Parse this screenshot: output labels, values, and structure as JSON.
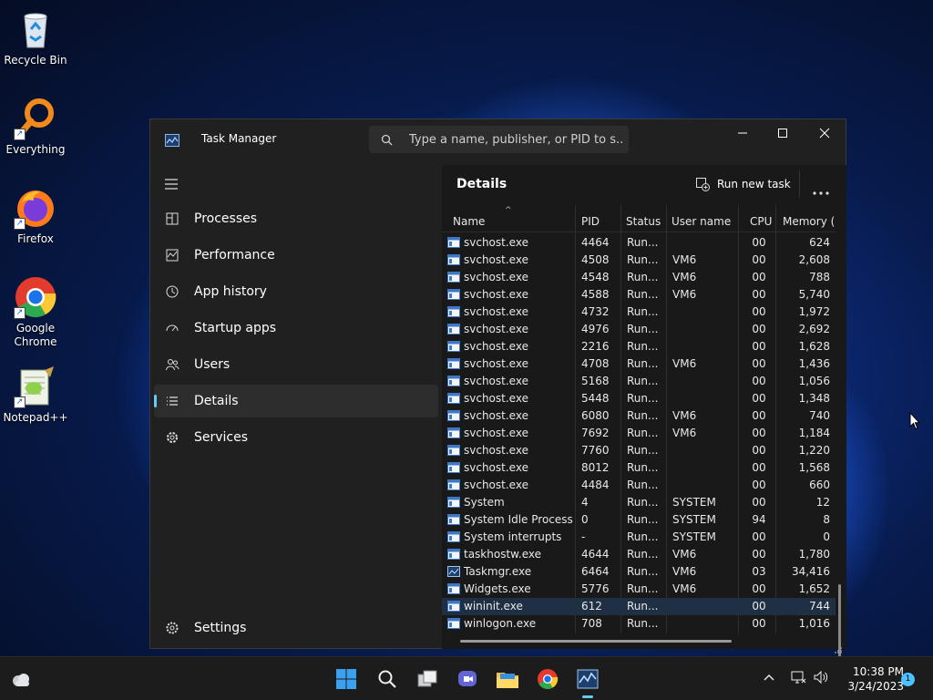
{
  "desktop": {
    "icons": [
      {
        "label": "Recycle Bin",
        "icon": "recycle-bin-icon"
      },
      {
        "label": "Everything",
        "icon": "everything-search-icon"
      },
      {
        "label": "Firefox",
        "icon": "firefox-icon"
      },
      {
        "label": "Google Chrome",
        "icon": "chrome-icon"
      },
      {
        "label": "Notepad++",
        "icon": "notepad-plus-plus-icon"
      }
    ]
  },
  "task_manager": {
    "title": "Task Manager",
    "search": {
      "placeholder": "Type a name, publisher, or PID to s..."
    },
    "nav": {
      "items": [
        {
          "label": "Processes",
          "icon": "processes-icon"
        },
        {
          "label": "Performance",
          "icon": "performance-icon"
        },
        {
          "label": "App history",
          "icon": "app-history-icon"
        },
        {
          "label": "Startup apps",
          "icon": "startup-apps-icon"
        },
        {
          "label": "Users",
          "icon": "users-icon"
        },
        {
          "label": "Details",
          "icon": "details-icon",
          "active": true
        },
        {
          "label": "Services",
          "icon": "services-icon"
        }
      ],
      "settings": "Settings"
    },
    "details": {
      "title": "Details",
      "run_new_task": "Run new task",
      "columns": [
        "Name",
        "PID",
        "Status",
        "User name",
        "CPU",
        "Memory ("
      ],
      "rows": [
        {
          "name": "svchost.exe",
          "pid": "4464",
          "status": "Run...",
          "user": "",
          "cpu": "00",
          "mem": "624"
        },
        {
          "name": "svchost.exe",
          "pid": "4508",
          "status": "Run...",
          "user": "VM6",
          "cpu": "00",
          "mem": "2,608"
        },
        {
          "name": "svchost.exe",
          "pid": "4548",
          "status": "Run...",
          "user": "VM6",
          "cpu": "00",
          "mem": "788"
        },
        {
          "name": "svchost.exe",
          "pid": "4588",
          "status": "Run...",
          "user": "VM6",
          "cpu": "00",
          "mem": "5,740"
        },
        {
          "name": "svchost.exe",
          "pid": "4732",
          "status": "Run...",
          "user": "",
          "cpu": "00",
          "mem": "1,972"
        },
        {
          "name": "svchost.exe",
          "pid": "4976",
          "status": "Run...",
          "user": "",
          "cpu": "00",
          "mem": "2,692"
        },
        {
          "name": "svchost.exe",
          "pid": "2216",
          "status": "Run...",
          "user": "",
          "cpu": "00",
          "mem": "1,628"
        },
        {
          "name": "svchost.exe",
          "pid": "4708",
          "status": "Run...",
          "user": "VM6",
          "cpu": "00",
          "mem": "1,436"
        },
        {
          "name": "svchost.exe",
          "pid": "5168",
          "status": "Run...",
          "user": "",
          "cpu": "00",
          "mem": "1,056"
        },
        {
          "name": "svchost.exe",
          "pid": "5448",
          "status": "Run...",
          "user": "",
          "cpu": "00",
          "mem": "1,348"
        },
        {
          "name": "svchost.exe",
          "pid": "6080",
          "status": "Run...",
          "user": "VM6",
          "cpu": "00",
          "mem": "740"
        },
        {
          "name": "svchost.exe",
          "pid": "7692",
          "status": "Run...",
          "user": "VM6",
          "cpu": "00",
          "mem": "1,184"
        },
        {
          "name": "svchost.exe",
          "pid": "7760",
          "status": "Run...",
          "user": "",
          "cpu": "00",
          "mem": "1,220"
        },
        {
          "name": "svchost.exe",
          "pid": "8012",
          "status": "Run...",
          "user": "",
          "cpu": "00",
          "mem": "1,568"
        },
        {
          "name": "svchost.exe",
          "pid": "4484",
          "status": "Run...",
          "user": "",
          "cpu": "00",
          "mem": "660"
        },
        {
          "name": "System",
          "pid": "4",
          "status": "Run...",
          "user": "SYSTEM",
          "cpu": "00",
          "mem": "12"
        },
        {
          "name": "System Idle Process",
          "pid": "0",
          "status": "Run...",
          "user": "SYSTEM",
          "cpu": "94",
          "mem": "8"
        },
        {
          "name": "System interrupts",
          "pid": "-",
          "status": "Run...",
          "user": "SYSTEM",
          "cpu": "00",
          "mem": "0"
        },
        {
          "name": "taskhostw.exe",
          "pid": "4644",
          "status": "Run...",
          "user": "VM6",
          "cpu": "00",
          "mem": "1,780"
        },
        {
          "name": "Taskmgr.exe",
          "pid": "6464",
          "status": "Run...",
          "user": "VM6",
          "cpu": "03",
          "mem": "34,416",
          "icon": "taskmgr"
        },
        {
          "name": "Widgets.exe",
          "pid": "5776",
          "status": "Run...",
          "user": "VM6",
          "cpu": "00",
          "mem": "1,652"
        },
        {
          "name": "wininit.exe",
          "pid": "612",
          "status": "Run...",
          "user": "",
          "cpu": "00",
          "mem": "744",
          "selected": true
        },
        {
          "name": "winlogon.exe",
          "pid": "708",
          "status": "Run...",
          "user": "",
          "cpu": "00",
          "mem": "1,016"
        }
      ]
    }
  },
  "taskbar": {
    "apps": [
      "start-icon",
      "search-icon",
      "task-view-icon",
      "chat-icon",
      "file-explorer-icon",
      "chrome-icon",
      "task-manager-icon"
    ],
    "clock": {
      "time": "10:38 PM",
      "date": "3/24/2023"
    },
    "notification_count": "1"
  }
}
